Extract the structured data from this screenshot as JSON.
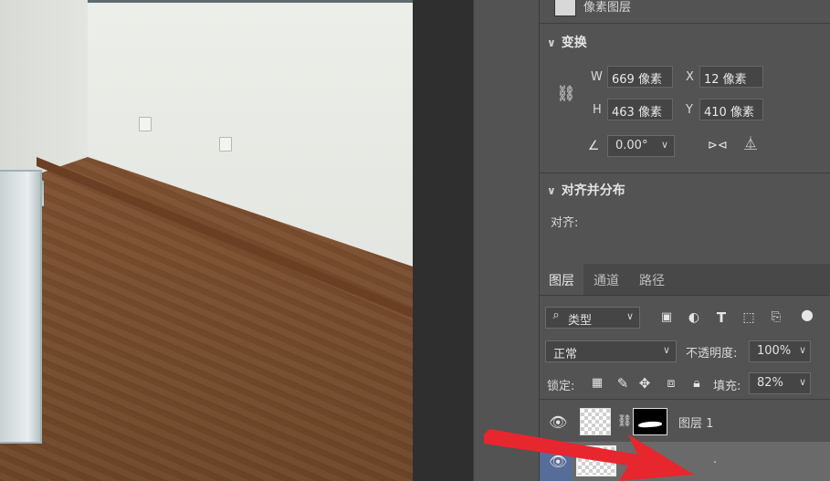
{
  "properties": {
    "layer_kind": "像素图层",
    "transform": {
      "title": "变换",
      "w_label": "W",
      "w_value": "669 像素",
      "h_label": "H",
      "h_value": "463 像素",
      "x_label": "X",
      "x_value": "12 像素",
      "y_label": "Y",
      "y_value": "410 像素",
      "angle_value": "0.00°"
    },
    "align": {
      "title": "对齐并分布",
      "label": "对齐:"
    }
  },
  "layers_panel": {
    "tabs": [
      "图层",
      "通道",
      "路径"
    ],
    "filter_label": "类型",
    "blend_mode": "正常",
    "opacity_label": "不透明度:",
    "opacity_value": "100%",
    "lock_label": "锁定:",
    "fill_label": "填充:",
    "fill_value": "82%",
    "layers": [
      {
        "name": "图层 1"
      },
      {
        "name": "."
      }
    ]
  },
  "colors": {
    "panel_bg": "#535353",
    "annotation_arrow": "#e8262d",
    "selected_layer": "#6a6a6a"
  }
}
